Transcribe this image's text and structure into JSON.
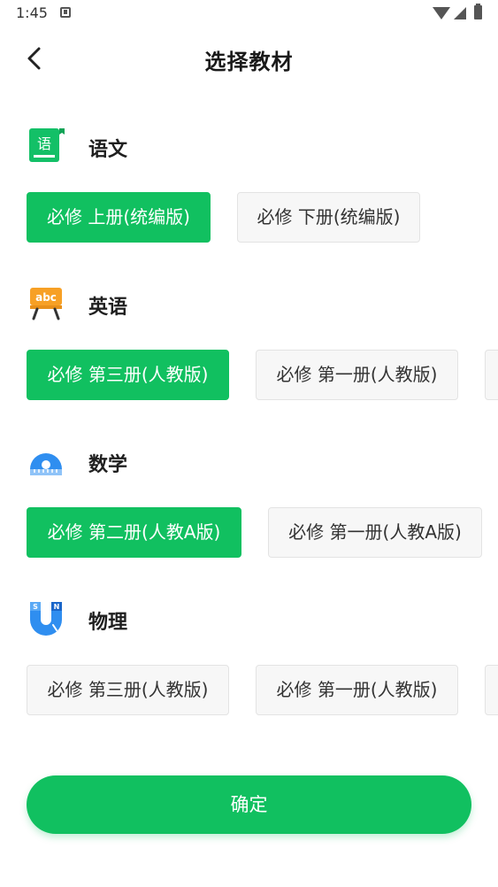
{
  "status_bar": {
    "time": "1:45"
  },
  "header": {
    "title": "选择教材"
  },
  "subjects": [
    {
      "name": "语文",
      "icon": "chinese-book-icon",
      "icon_glyph": "语",
      "options": [
        "必修 上册(统编版)",
        "必修 下册(统编版)"
      ]
    },
    {
      "name": "英语",
      "icon": "english-abc-board-icon",
      "icon_glyph": "abc",
      "options": [
        "必修 第三册(人教版)",
        "必修 第一册(人教版)"
      ]
    },
    {
      "name": "数学",
      "icon": "math-protractor-icon",
      "options": [
        "必修 第二册(人教A版)",
        "必修 第一册(人教A版)"
      ]
    },
    {
      "name": "物理",
      "icon": "physics-magnet-icon",
      "icon_glyph_s": "S",
      "icon_glyph_n": "N",
      "options": [
        "必修 第三册(人教版)",
        "必修 第一册(人教版)"
      ]
    }
  ],
  "selected": {
    "语文": "必修 上册(统编版)",
    "英语": "必修 第三册(人教版)",
    "数学": "必修 第二册(人教A版)",
    "物理": null
  },
  "confirm_label": "确定",
  "colors": {
    "accent": "#11c060",
    "chip_bg": "#f7f7f7",
    "chip_border": "#e3e3e3"
  }
}
